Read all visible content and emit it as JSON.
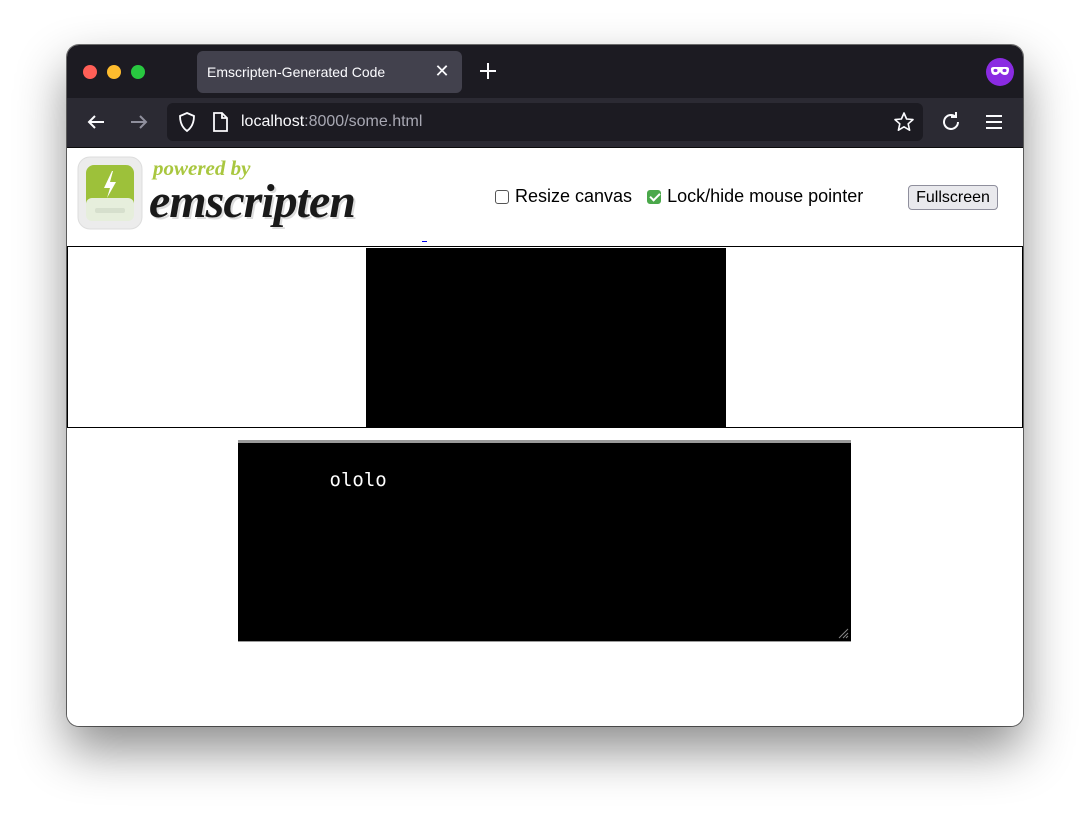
{
  "browser": {
    "tab": {
      "title": "Emscripten-Generated Code",
      "close_glyph": "✕"
    },
    "new_tab_icon": "plus-icon",
    "extension_icon": "private-browsing-mask-icon",
    "accent_color": "#8a2be2",
    "url": {
      "host": "localhost",
      "path": ":8000/some.html"
    }
  },
  "page": {
    "logo": {
      "tagline": "powered by",
      "brand": "emscripten",
      "tagline_color": "#a9c73f"
    },
    "controls": {
      "resize_canvas": {
        "label": "Resize canvas",
        "checked": false
      },
      "lock_pointer": {
        "label": "Lock/hide mouse pointer",
        "checked": true
      },
      "fullscreen_label": "Fullscreen"
    },
    "output": {
      "text": "ololo"
    }
  }
}
